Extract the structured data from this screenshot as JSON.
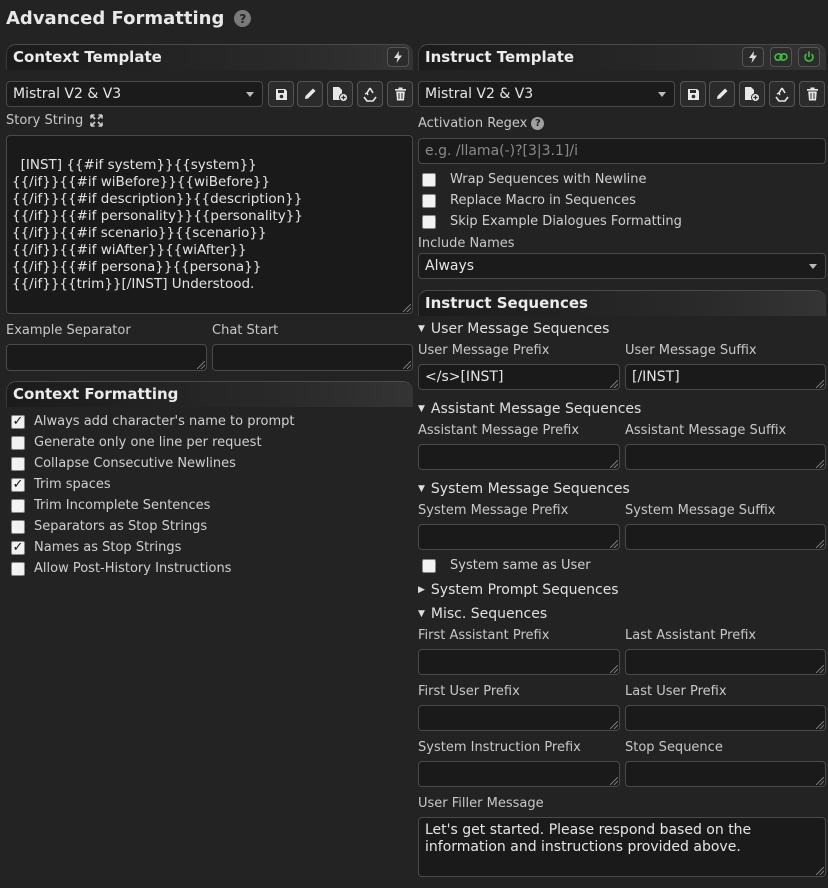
{
  "page": {
    "title": "Advanced Formatting"
  },
  "context": {
    "header": "Context Template",
    "preset": "Mistral V2 & V3",
    "story_label": "Story String",
    "story_string": "[INST] {{#if system}}{{system}}\n{{/if}}{{#if wiBefore}}{{wiBefore}}\n{{/if}}{{#if description}}{{description}}\n{{/if}}{{#if personality}}{{personality}}\n{{/if}}{{#if scenario}}{{scenario}}\n{{/if}}{{#if wiAfter}}{{wiAfter}}\n{{/if}}{{#if persona}}{{persona}}\n{{/if}}{{trim}}[/INST] Understood.",
    "example_separator_label": "Example Separator",
    "example_separator_value": "",
    "chat_start_label": "Chat Start",
    "chat_start_value": ""
  },
  "context_formatting": {
    "header": "Context Formatting",
    "options": [
      {
        "label": "Always add character's name to prompt",
        "checked": true
      },
      {
        "label": "Generate only one line per request",
        "checked": false
      },
      {
        "label": "Collapse Consecutive Newlines",
        "checked": false
      },
      {
        "label": "Trim spaces",
        "checked": true
      },
      {
        "label": "Trim Incomplete Sentences",
        "checked": false
      },
      {
        "label": "Separators as Stop Strings",
        "checked": false
      },
      {
        "label": "Names as Stop Strings",
        "checked": true
      },
      {
        "label": "Allow Post-History Instructions",
        "checked": false
      }
    ]
  },
  "instruct": {
    "header": "Instruct Template",
    "preset": "Mistral V2 & V3",
    "activation_regex_label": "Activation Regex",
    "activation_regex_placeholder": "e.g. /llama(-)?[3|3.1]/i",
    "options": [
      {
        "label": "Wrap Sequences with Newline",
        "checked": false
      },
      {
        "label": "Replace Macro in Sequences",
        "checked": false
      },
      {
        "label": "Skip Example Dialogues Formatting",
        "checked": false
      }
    ],
    "include_names_label": "Include Names",
    "include_names_value": "Always"
  },
  "sequences": {
    "header": "Instruct Sequences",
    "user": {
      "title": "User Message Sequences",
      "prefix_label": "User Message Prefix",
      "prefix_value": "</s>[INST]",
      "suffix_label": "User Message Suffix",
      "suffix_value": "[/INST]"
    },
    "assistant": {
      "title": "Assistant Message Sequences",
      "prefix_label": "Assistant Message Prefix",
      "prefix_value": "",
      "suffix_label": "Assistant Message Suffix",
      "suffix_value": ""
    },
    "system": {
      "title": "System Message Sequences",
      "prefix_label": "System Message Prefix",
      "prefix_value": "",
      "suffix_label": "System Message Suffix",
      "suffix_value": "",
      "same_as_user_label": "System same as User",
      "same_as_user_checked": false
    },
    "system_prompt": {
      "title": "System Prompt Sequences"
    },
    "misc": {
      "title": "Misc. Sequences",
      "first_assistant_prefix_label": "First Assistant Prefix",
      "last_assistant_prefix_label": "Last Assistant Prefix",
      "first_user_prefix_label": "First User Prefix",
      "last_user_prefix_label": "Last User Prefix",
      "system_instruction_prefix_label": "System Instruction Prefix",
      "stop_sequence_label": "Stop Sequence",
      "user_filler_label": "User Filler Message",
      "user_filler_value": "Let's get started. Please respond based on the information and instructions provided above."
    }
  },
  "icons": {
    "accent_green": "#3fbf3f",
    "help": "question-circle-icon",
    "bolt": "bolt-icon",
    "link": "link-icon",
    "power": "power-icon",
    "save": "floppy-disk-icon",
    "rename": "pencil-icon",
    "new": "file-plus-icon",
    "restore": "recycle-icon",
    "delete": "trash-icon",
    "expand": "expand-arrows-icon"
  }
}
